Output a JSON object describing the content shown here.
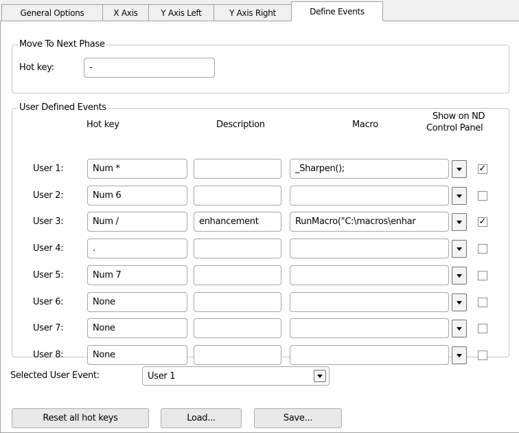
{
  "tabs": [
    "General Options",
    "X Axis",
    "Y Axis Left",
    "Y Axis Right",
    "Define Events"
  ],
  "move_group": {
    "title": "Move To Next Phase",
    "hotkey_label": "Hot key:",
    "hotkey_value": "-"
  },
  "user_group": {
    "title": "User Defined Events",
    "headers": {
      "hotkey": "Hot key",
      "description": "Description",
      "macro": "Macro",
      "show_line1": "Show on ND",
      "show_line2": "Control Panel"
    },
    "rows": [
      {
        "label": "User 1:",
        "hotkey": "Num *",
        "description": "",
        "macro": "_Sharpen();",
        "show": true
      },
      {
        "label": "User 2:",
        "hotkey": "Num 6",
        "description": "",
        "macro": "",
        "show": false
      },
      {
        "label": "User 3:",
        "hotkey": "Num /",
        "description": "enhancement",
        "macro": "RunMacro(\"C:\\macros\\enhar",
        "show": true
      },
      {
        "label": "User 4:",
        "hotkey": ".",
        "description": "",
        "macro": "",
        "show": false
      },
      {
        "label": "User 5:",
        "hotkey": "Num 7",
        "description": "",
        "macro": "",
        "show": false
      },
      {
        "label": "User 6:",
        "hotkey": "None",
        "description": "",
        "macro": "",
        "show": false
      },
      {
        "label": "User 7:",
        "hotkey": "None",
        "description": "",
        "macro": "",
        "show": false
      },
      {
        "label": "User 8:",
        "hotkey": "None",
        "description": "",
        "macro": "",
        "show": false
      }
    ]
  },
  "selected_event": {
    "label": "Selected User Event:",
    "value": "User 1"
  },
  "buttons": {
    "reset": "Reset all hot keys",
    "load": "Load...",
    "save": "Save..."
  },
  "icons": {
    "dropdown": "chevron-down-icon",
    "check": "checkmark-icon"
  }
}
